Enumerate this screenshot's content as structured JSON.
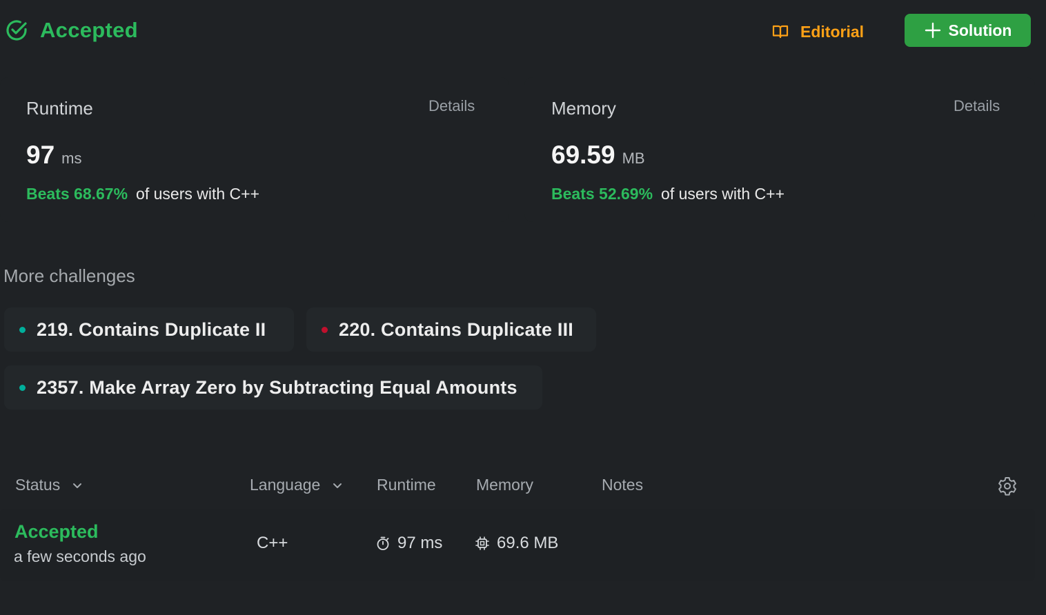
{
  "header": {
    "status_title": "Accepted",
    "editorial_label": "Editorial",
    "solution_label": "Solution"
  },
  "runtime_card": {
    "label": "Runtime",
    "details_label": "Details",
    "value": "97",
    "unit": "ms",
    "beats": "Beats 68.67%",
    "beats_tail": "of users with C++"
  },
  "memory_card": {
    "label": "Memory",
    "details_label": "Details",
    "value": "69.59",
    "unit": "MB",
    "beats": "Beats 52.69%",
    "beats_tail": "of users with C++"
  },
  "more_challenges": {
    "heading": "More challenges",
    "items": [
      {
        "label": "219. Contains Duplicate II",
        "difficulty_color": "#00af9b"
      },
      {
        "label": "220. Contains Duplicate III",
        "difficulty_color": "#c0102d"
      },
      {
        "label": "2357. Make Array Zero by Subtracting Equal Amounts",
        "difficulty_color": "#00af9b"
      }
    ]
  },
  "submissions_table": {
    "columns": [
      "Status",
      "Language",
      "Runtime",
      "Memory",
      "Notes"
    ],
    "rows": [
      {
        "status": "Accepted",
        "time_ago": "a few seconds ago",
        "language": "C++",
        "runtime": "97 ms",
        "memory": "69.6 MB",
        "notes": ""
      }
    ]
  },
  "icons": {
    "status": "check-circle-icon",
    "editorial": "book-icon",
    "solution": "plus-icon",
    "column_sort": "chevron-down-icon",
    "settings": "gear-icon",
    "runtime_cell": "stopwatch-icon",
    "memory_cell": "chip-icon"
  },
  "colors": {
    "accepted_green": "#2cbb5d",
    "editorial_orange": "#ffa116",
    "solution_button": "#2ea043",
    "background": "#1f2225"
  }
}
